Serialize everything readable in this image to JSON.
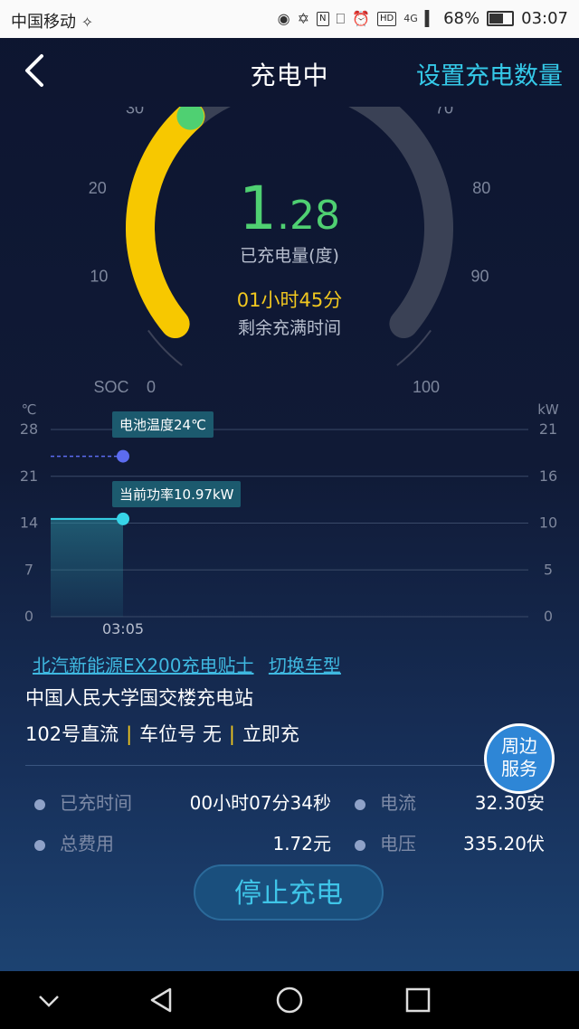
{
  "status_bar": {
    "carrier": "中国移动",
    "network": "4G",
    "battery": "68%",
    "battery_level": 0.68,
    "time": "03:07",
    "icons": [
      "location-icon",
      "bluetooth-icon",
      "nfc-icon",
      "vibrate-icon",
      "alarm-icon",
      "hd-icon",
      "signal-icon",
      "battery-icon"
    ]
  },
  "header": {
    "title": "充电中",
    "action": "设置充电数量",
    "back_icon": "chevron-left-icon"
  },
  "gauge": {
    "soc_label": "SOC",
    "ticks": [
      "0",
      "10",
      "20",
      "30",
      "70",
      "80",
      "90",
      "100"
    ],
    "soc_percent": 34,
    "charged_int": "1",
    "charged_dot": ".",
    "charged_dec": "28",
    "charged_label": "已充电量(度)",
    "remaining_time": "01小时45分",
    "remaining_label": "剩余充满时间",
    "colors": {
      "track": "#3a4155",
      "fill": "#f7c800",
      "end": "#4fd072"
    }
  },
  "chart_data": {
    "type": "line",
    "left_unit": "℃",
    "right_unit": "kW",
    "left_ticks": [
      "0",
      "7",
      "14",
      "21",
      "28"
    ],
    "right_ticks": [
      "0",
      "5",
      "10",
      "16",
      "21"
    ],
    "left_range": [
      0,
      28
    ],
    "right_range": [
      0,
      21
    ],
    "x_labels": [
      "03:05"
    ],
    "series": [
      {
        "name": "电池温度",
        "axis": "left",
        "values": [
          24,
          24
        ]
      },
      {
        "name": "当前功率",
        "axis": "right",
        "values": [
          10.97,
          10.97
        ]
      }
    ],
    "temp_tooltip": "电池温度24℃",
    "power_tooltip": "当前功率10.97kW",
    "colors": {
      "temp": "#5c6cf0",
      "power": "#37d4e8"
    }
  },
  "info": {
    "vehicle_tips": "北汽新能源EX200充电贴士",
    "switch_vehicle": "切换车型",
    "station": "中国人民大学国交楼充电站",
    "pile": "102号直流",
    "parking": "车位号 无",
    "mode": "立即充",
    "nearby_service": [
      "周边",
      "服务"
    ]
  },
  "stats": {
    "charged_time_label": "已充时间",
    "charged_time_value": "00小时07分34秒",
    "current_label": "电流",
    "current_value": "32.30安",
    "total_cost_label": "总费用",
    "total_cost_value": "1.72元",
    "voltage_label": "电压",
    "voltage_value": "335.20伏"
  },
  "stop_button": "停止充电",
  "system_nav": [
    "chevron-down-icon",
    "back-triangle-icon",
    "home-circle-icon",
    "recents-square-icon"
  ]
}
